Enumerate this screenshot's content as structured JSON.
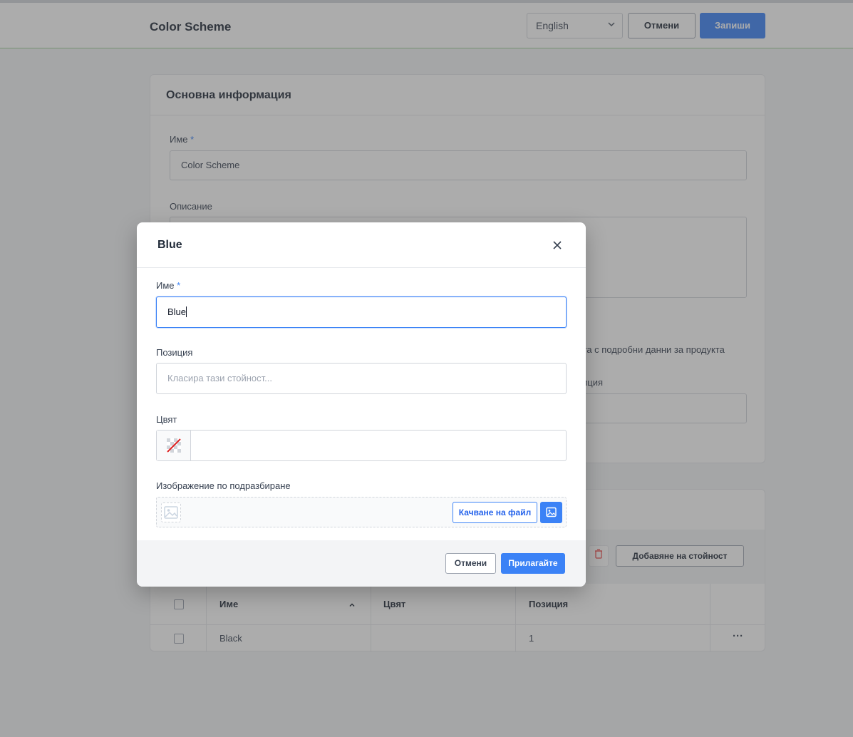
{
  "header": {
    "title": "Color Scheme",
    "language": "English",
    "cancel_label": "Отмени",
    "save_label": "Запиши"
  },
  "main_card": {
    "title": "Основна информация",
    "name_label": "Име",
    "required_mark": "*",
    "name_value": "Color Scheme",
    "description_label": "Описание",
    "partial_text_1": "дата с подробни данни за продукта",
    "partial_text_2": "иция"
  },
  "values_card": {
    "add_value_label": "Добавяне на стойност",
    "columns": [
      "Име",
      "Цвят",
      "Позиция"
    ],
    "rows": [
      {
        "name": "Black",
        "color": "",
        "position": "1",
        "actions": "···"
      }
    ]
  },
  "modal": {
    "title": "Blue",
    "name_label": "Име",
    "required_mark": "*",
    "name_value": "Blue",
    "position_label": "Позиция",
    "position_placeholder": "Класира тази стойност...",
    "color_label": "Цвят",
    "color_value": "",
    "image_label": "Изображение по подразбиране",
    "upload_label": "Качване на файл",
    "cancel_label": "Отмени",
    "apply_label": "Прилагайте"
  },
  "colors": {
    "accent": "#3b82f6",
    "danger": "#ef4444"
  }
}
